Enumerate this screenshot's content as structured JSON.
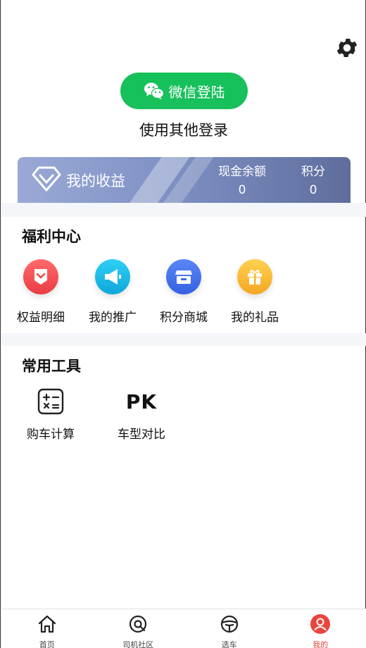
{
  "header": {
    "settings_icon": "gear-icon"
  },
  "login": {
    "wechat_label": "微信登陆",
    "wechat_icon": "wechat-icon",
    "wechat_color": "#16c05a",
    "other_login": "使用其他登录"
  },
  "earnings": {
    "title": "我的收益",
    "cash_label": "现金余额",
    "cash_value": "0",
    "points_label": "积分",
    "points_value": "0"
  },
  "welfare": {
    "title": "福利中心",
    "items": [
      {
        "label": "权益明细",
        "icon": "badge-icon",
        "color": "#f0474c"
      },
      {
        "label": "我的推广",
        "icon": "megaphone-icon",
        "color": "#17b8e6"
      },
      {
        "label": "积分商城",
        "icon": "store-icon",
        "color": "#3f6fe6"
      },
      {
        "label": "我的礼品",
        "icon": "gift-icon",
        "color": "#f7b52c"
      }
    ]
  },
  "tools": {
    "title": "常用工具",
    "items": [
      {
        "label": "购车计算",
        "icon": "calculator-icon"
      },
      {
        "label": "车型对比",
        "icon_text": "PK"
      }
    ]
  },
  "tabbar": {
    "active_color": "#e8453c",
    "items": [
      {
        "label": "首页",
        "icon": "home-icon"
      },
      {
        "label": "司机社区",
        "icon": "community-icon"
      },
      {
        "label": "选车",
        "icon": "steering-wheel-icon"
      },
      {
        "label": "我的",
        "icon": "profile-icon",
        "active": true
      }
    ]
  }
}
